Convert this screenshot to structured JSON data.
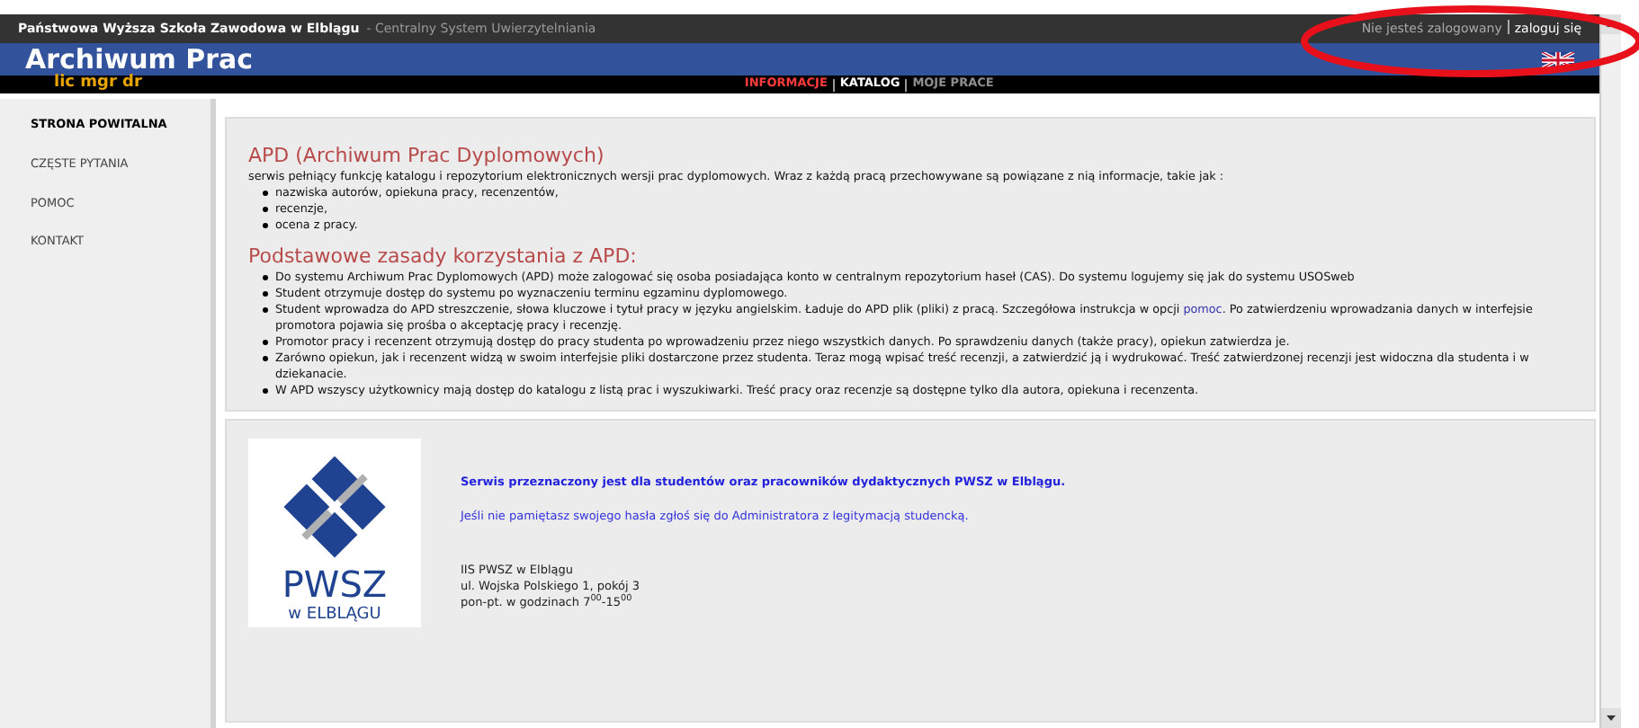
{
  "header": {
    "institution": "Państwowa Wyższa Szkoła Zawodowa w Elblągu",
    "system": "- Centralny System Uwierzytelniania",
    "login_status": "Nie jesteś zalogowany",
    "login_link": "zaloguj się"
  },
  "app": {
    "title": "Archiwum Prac",
    "subtitle": "lic mgr dr"
  },
  "nav": [
    {
      "label": "INFORMACJE",
      "selected": true,
      "disabled": false
    },
    {
      "label": "KATALOG",
      "selected": false,
      "disabled": false
    },
    {
      "label": "MOJE PRACE",
      "selected": false,
      "disabled": true
    }
  ],
  "sidebar": {
    "items": [
      {
        "label": "STRONA POWITALNA",
        "selected": true
      },
      {
        "label": "CZĘSTE PYTANIA",
        "selected": false
      },
      {
        "label": "POMOC",
        "selected": false
      },
      {
        "label": "KONTAKT",
        "selected": false
      }
    ]
  },
  "intro": {
    "heading": "APD (Archiwum Prac Dyplomowych)",
    "text": "serwis pełniący funkcję katalogu i repozytorium elektronicznych wersji prac dyplomowych. Wraz z każdą pracą przechowywane są powiązane z nią informacje, takie jak :",
    "items": [
      "nazwiska autorów, opiekuna pracy, recenzentów,",
      "recenzje,",
      "ocena z pracy."
    ]
  },
  "rules": {
    "heading": "Podstawowe zasady korzystania z APD:",
    "items": [
      {
        "text": "Do systemu Archiwum Prac Dyplomowych (APD) może zalogować się osoba posiadająca konto w centralnym repozytorium haseł (CAS). Do systemu logujemy się jak do systemu USOSweb"
      },
      {
        "text": "Student otrzymuje dostęp do systemu po wyznaczeniu terminu egzaminu dyplomowego."
      },
      {
        "text": "Student wprowadza do APD streszczenie, słowa kluczowe i tytuł pracy w języku angielskim. Ładuje do APD plik (pliki) z pracą. Szczegółowa instrukcja w opcji",
        "link": "pomoc",
        "after": ". Po zatwierdzeniu wprowadzania danych w interfejsie promotora pojawia się prośba o akceptację pracy i recenzję."
      },
      {
        "text": "Promotor pracy i recenzent otrzymują dostęp do pracy studenta po wprowadzeniu przez niego wszystkich danych. Po sprawdzeniu danych (także pracy), opiekun zatwierdza je."
      },
      {
        "text": "Zarówno opiekun, jak i recenzent widzą w swoim interfejsie pliki dostarczone przez studenta. Teraz mogą wpisać treść recenzji, a zatwierdzić ją i wydrukować. Treść zatwierdzonej recenzji jest widoczna dla studenta i w dziekanacie."
      },
      {
        "text": "W APD wszyscy użytkownicy mają dostęp do katalogu z listą prac i wyszukiwarki. Treść pracy oraz recenzje są dostępne tylko dla autora, opiekuna i recenzenta."
      }
    ]
  },
  "contact": {
    "logo_name": "PWSZ",
    "logo_city": "w ELBLĄGU",
    "notice": "Serwis przeznaczony jest dla studentów oraz pracowników dydaktycznych PWSZ w Elblągu.",
    "password_note": "Jeśli nie pamiętasz swojego hasła zgłoś się do Administratora z legitymacją studencką.",
    "address": [
      "IIS PWSZ w Elblągu",
      "ul. Wojska Polskiego 1, pokój 3",
      "pon-pt. w godzinach 7$^{00}$-15$^{00}$"
    ]
  }
}
